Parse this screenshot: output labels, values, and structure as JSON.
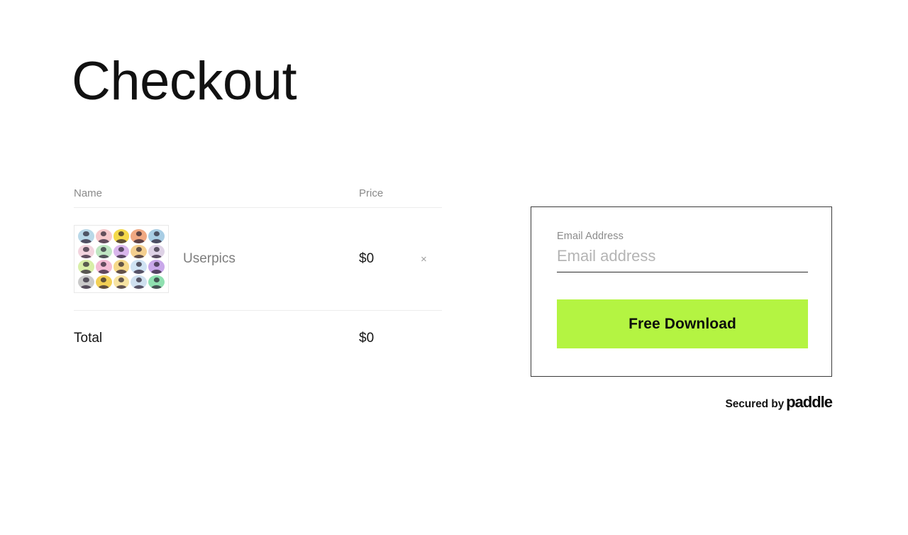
{
  "page": {
    "title": "Checkout",
    "background_color": "#ffffff"
  },
  "cart": {
    "columns": {
      "name": "Name",
      "price": "Price"
    },
    "items": [
      {
        "thumbnail": "userpics-avatar-grid",
        "name": "Userpics",
        "price": "$0",
        "remove_label": "×"
      }
    ],
    "total": {
      "label": "Total",
      "value": "$0"
    }
  },
  "checkout": {
    "email": {
      "label": "Email Address",
      "value": "",
      "placeholder": "Email address"
    },
    "submit_label": "Free Download",
    "accent_color": "#b4f442"
  },
  "footer": {
    "secured_text": "Secured by",
    "provider": "paddle"
  },
  "avatar_grid": {
    "rows": 4,
    "columns": 5,
    "colors": [
      "#b9d8e8",
      "#f7c9cc",
      "#f4d94a",
      "#f0a882",
      "#a8cde4",
      "#f2d4de",
      "#bfe6c2",
      "#d9b6ec",
      "#f4cf8f",
      "#ded2e6",
      "#d8efa8",
      "#f4bcd6",
      "#f6d98a",
      "#cfe3f3",
      "#c9a8ea",
      "#c9c9c9",
      "#f2cf55",
      "#f7e3a2",
      "#cfe0ef",
      "#8fe0b0"
    ]
  }
}
